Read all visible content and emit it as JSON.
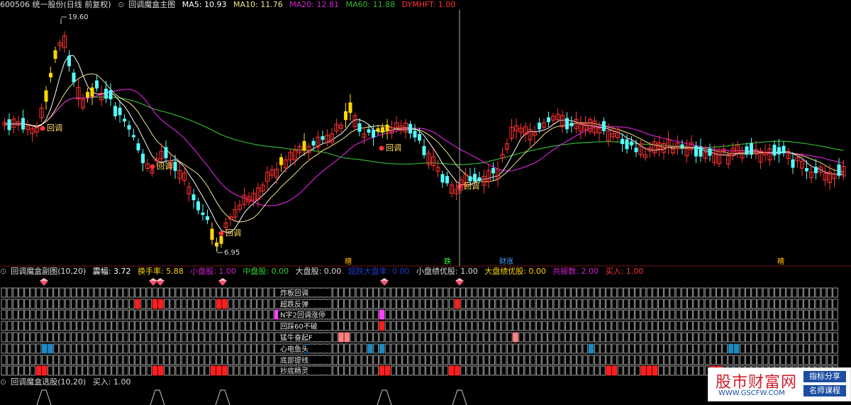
{
  "main_header": {
    "code_name": "600506 统一股份(日线 前复权)",
    "indicator_name": "回调魔盒主图",
    "ma5": "MA5: 10.93",
    "ma10": "MA10: 11.76",
    "ma20": "MA20: 12.81",
    "ma60": "MA60: 11.88",
    "dymhft": "DYMHFT: 1.00"
  },
  "main_chart": {
    "price_high": "19.60",
    "price_low": "6.95",
    "signal_label": "回调",
    "event_markers": [
      "糟",
      "跌",
      "财涨",
      "糟"
    ],
    "colors": {
      "up": "#ff3232",
      "down": "#54ffff",
      "yellow": "#ffd700",
      "ma5": "#ffffff",
      "ma10": "#f0e68c",
      "ma20": "#d020d0",
      "ma60": "#32b432"
    }
  },
  "sub_header": {
    "name": "回调魔盒副图(10,20)",
    "amplitude": "震幅: 3.72",
    "turnover": "换手率: 5.88",
    "small_cap": "小盘股: 1.00",
    "mid_cap": "中盘股: 0.00",
    "large_cap": "大盘股: 0.00",
    "dark_item": "超跌大盘率: 0.00",
    "small_quality": "小盘绩优股: 1.00",
    "large_quality": "大盘绩优股: 0.00",
    "resonance": "共振数: 2.00",
    "buy": "买入: 1.00"
  },
  "sub_chart": {
    "rows": [
      "炸板回调",
      "超跌反弹",
      "N字2回调涨停",
      "回踩60不破",
      "猛牛奋起F",
      "心电鱼头",
      "底部提线",
      "抄底精灵"
    ]
  },
  "sel_header": {
    "name": "回调魔盒选股(10,20)",
    "buy": "买入: 1.00"
  },
  "watermark": {
    "title": "股市财富网",
    "url": "WWW.GSCFW.COM",
    "btn1": "指标分享",
    "btn2": "名师课程"
  }
}
